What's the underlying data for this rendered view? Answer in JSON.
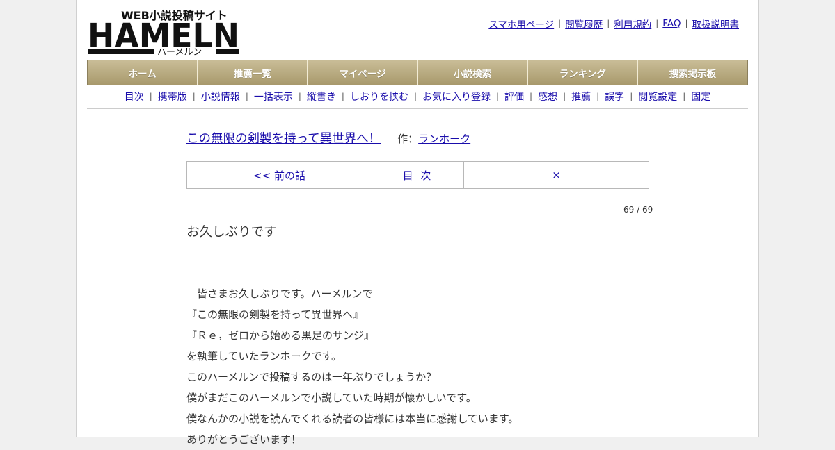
{
  "header": {
    "logo_tagline": "WEB小説投稿サイト",
    "logo_main": "HAMELN",
    "logo_kana": "ハーメルン",
    "links": [
      {
        "label": "スマホ用ページ"
      },
      {
        "label": "閲覧履歴"
      },
      {
        "label": "利用規約"
      },
      {
        "label": "FAQ"
      },
      {
        "label": "取扱説明書"
      }
    ]
  },
  "main_nav": [
    "ホーム",
    "推薦一覧",
    "マイページ",
    "小説検索",
    "ランキング",
    "捜索掲示板"
  ],
  "sub_nav": [
    "目次",
    "携帯版",
    "小説情報",
    "一括表示",
    "縦書き",
    "しおりを挟む",
    "お気に入り登録",
    "評価",
    "感想",
    "推薦",
    "誤字",
    "閲覧設定",
    "固定"
  ],
  "novel": {
    "title": "この無限の剣製を持って異世界へ！",
    "author_label": "作：",
    "author": "ランホーク"
  },
  "pager": {
    "prev": "<< 前の話",
    "toc": "目 次",
    "next": "×"
  },
  "counter": "69 / 69",
  "chapter_title": "お久しぶりです",
  "body_lines": [
    "　皆さまお久しぶりです。ハーメルンで",
    "『この無限の剣製を持って異世界へ』",
    "『Ｒｅ，ゼロから始める黒足のサンジ』",
    "を執筆していたランホークです。",
    "このハーメルンで投稿するのは一年ぶりでしょうか？",
    "僕がまだこのハーメルンで小説していた時期が懐かしいです。",
    "僕なんかの小説を読んでくれる読者の皆様には本当に感謝しています。",
    "ありがとうございます！"
  ],
  "colors": {
    "link": "#1a0dab",
    "nav_bar": "#a8996c",
    "page_bg": "#f0f0f0"
  }
}
